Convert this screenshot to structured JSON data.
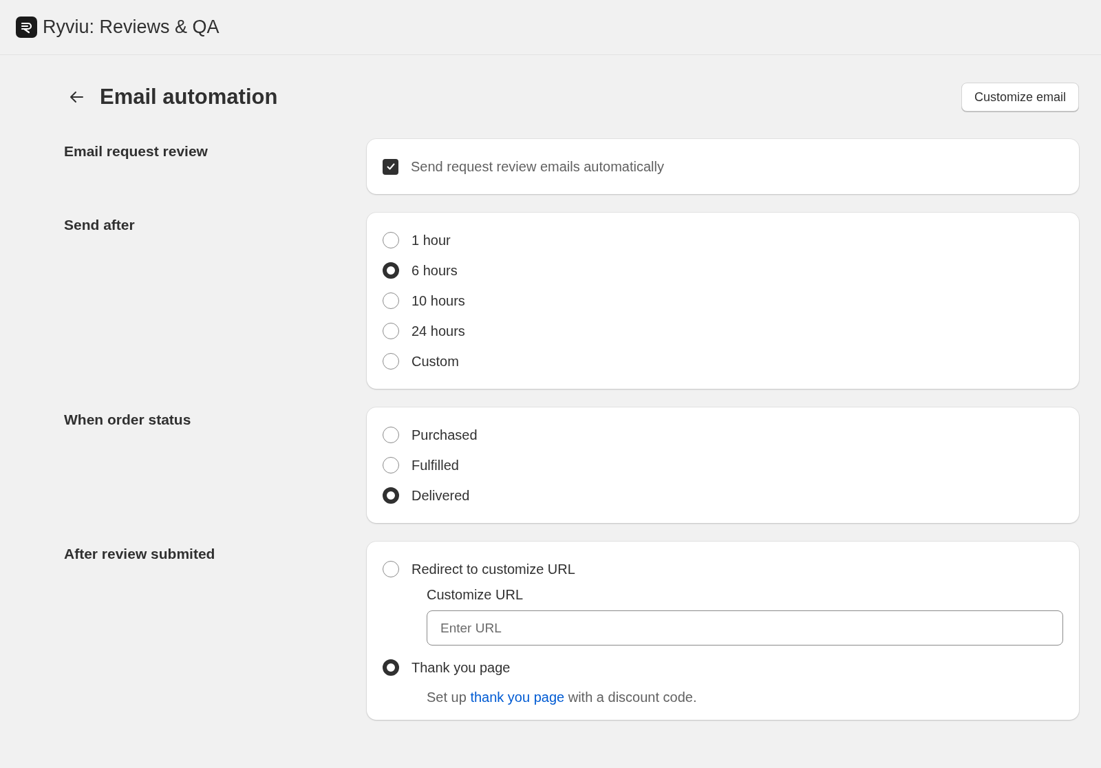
{
  "app": {
    "title": "Ryviu: Reviews & QA"
  },
  "page": {
    "title": "Email automation",
    "action": "Customize email"
  },
  "sections": [
    {
      "label": "Email request review",
      "kind": "checkbox",
      "options": [
        {
          "label": "Send request review emails automatically",
          "checked": true
        }
      ]
    },
    {
      "label": "Send after",
      "kind": "radio",
      "options": [
        {
          "label": "1 hour",
          "selected": false
        },
        {
          "label": "6 hours",
          "selected": true
        },
        {
          "label": "10 hours",
          "selected": false
        },
        {
          "label": "24 hours",
          "selected": false
        },
        {
          "label": "Custom",
          "selected": false
        }
      ]
    },
    {
      "label": "When order status",
      "kind": "radio",
      "options": [
        {
          "label": "Purchased",
          "selected": false
        },
        {
          "label": "Fulfilled",
          "selected": false
        },
        {
          "label": "Delivered",
          "selected": true
        }
      ]
    },
    {
      "label": "After review submited",
      "kind": "radio",
      "options": [
        {
          "label": "Redirect to customize URL",
          "selected": false,
          "field": {
            "label": "Customize URL",
            "placeholder": "Enter URL"
          }
        },
        {
          "label": "Thank you page",
          "selected": true,
          "note": {
            "before": "Set up ",
            "link": "thank you page",
            "after": " with a discount code."
          }
        }
      ]
    }
  ]
}
